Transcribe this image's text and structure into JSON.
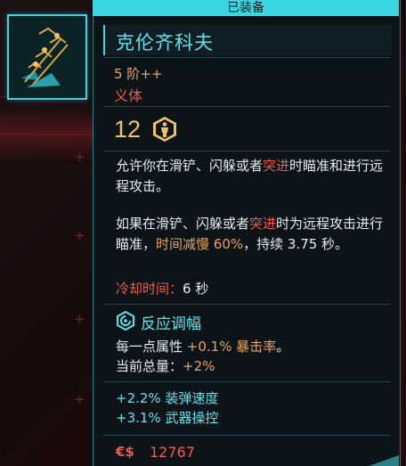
{
  "header": {
    "equipped_label": "已装备"
  },
  "item": {
    "name": "克伦齐科夫",
    "tier": "5 阶++",
    "type": "义体",
    "capacity_cost": "12"
  },
  "description": {
    "p1_a": "允许你在滑铲、闪躲或者",
    "p1_hl": "突进",
    "p1_b": "时瞄准和进行远程攻击。",
    "p2_a": "如果在滑铲、闪躲或者",
    "p2_hl": "突进",
    "p2_b": "时为远程攻击进行瞄准，",
    "p2_hl2": "时间减慢 60%",
    "p2_c": "，持续 3.75 秒。",
    "cooldown_label": "冷却时间：",
    "cooldown_value": "6 秒"
  },
  "attunement": {
    "title": "反应调幅",
    "line1_a": "每一点属性 ",
    "line1_hl": "+0.1% 暴击率",
    "line1_b": "。",
    "line2_a": "当前总量：",
    "line2_hl": "+2%"
  },
  "stats": [
    {
      "value": "+2.2%",
      "label": "装弹速度"
    },
    {
      "value": "+3.1%",
      "label": "武器操控"
    }
  ],
  "price": {
    "currency_icon": "€$",
    "value": "12767"
  },
  "colors": {
    "accent": "#3ad7e2",
    "red": "#ee5a4c",
    "orange": "#e9a35c",
    "gold": "#f0c268"
  },
  "icons": {
    "capacity": "humanoid-hexagon-icon",
    "attunement": "spiral-icon",
    "item": "cyberware-arm-icon"
  }
}
